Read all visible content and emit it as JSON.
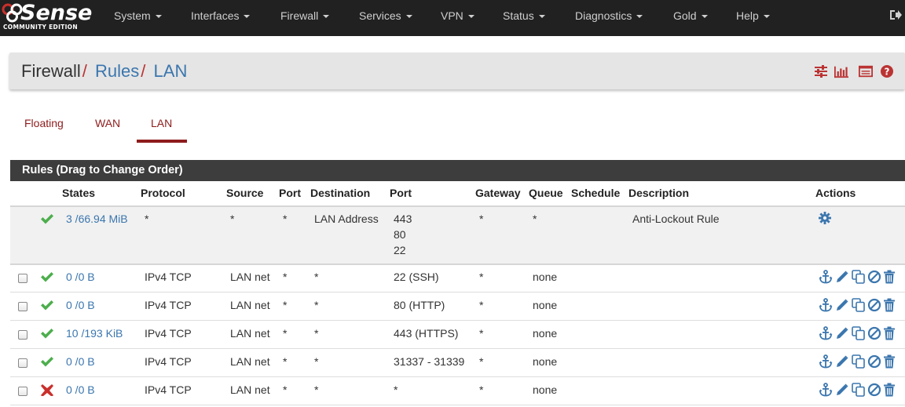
{
  "navbar": {
    "logo_text": "Sense",
    "logo_subtext": "COMMUNITY EDITION",
    "menu": [
      {
        "label": "System"
      },
      {
        "label": "Interfaces"
      },
      {
        "label": "Firewall"
      },
      {
        "label": "Services"
      },
      {
        "label": "VPN"
      },
      {
        "label": "Status"
      },
      {
        "label": "Diagnostics"
      },
      {
        "label": "Gold"
      },
      {
        "label": "Help"
      }
    ],
    "logout_icon": "sign-out-icon"
  },
  "breadcrumb": {
    "root": "Firewall",
    "sep": "/",
    "level1": "Rules",
    "level2": "LAN",
    "icons": [
      "sliders-icon",
      "bar-chart-icon",
      "list-table-icon",
      "help-icon"
    ]
  },
  "tabs": [
    {
      "label": "Floating",
      "active": false
    },
    {
      "label": "WAN",
      "active": false
    },
    {
      "label": "LAN",
      "active": true
    }
  ],
  "panel": {
    "title": "Rules (Drag to Change Order)",
    "columns": {
      "states": "States",
      "protocol": "Protocol",
      "source": "Source",
      "port": "Port",
      "destination": "Destination",
      "dport": "Port",
      "gateway": "Gateway",
      "queue": "Queue",
      "schedule": "Schedule",
      "description": "Description",
      "actions": "Actions"
    }
  },
  "rules": [
    {
      "status": "pass",
      "states": "3 /66.94 MiB",
      "protocol": "*",
      "source": "*",
      "sport": "*",
      "destination": "LAN Address",
      "dport_lines": [
        "443",
        "80",
        "22"
      ],
      "gateway": "*",
      "queue": "*",
      "schedule": "",
      "description": "Anti-Lockout Rule",
      "action_icon": "gear-icon"
    },
    {
      "status": "pass",
      "states": "0 /0 B",
      "protocol": "IPv4 TCP",
      "source": "LAN net",
      "sport": "*",
      "destination": "*",
      "dport": "22 (SSH)",
      "gateway": "*",
      "queue": "none",
      "schedule": "",
      "description": ""
    },
    {
      "status": "pass",
      "states": "0 /0 B",
      "protocol": "IPv4 TCP",
      "source": "LAN net",
      "sport": "*",
      "destination": "*",
      "dport": "80 (HTTP)",
      "gateway": "*",
      "queue": "none",
      "schedule": "",
      "description": ""
    },
    {
      "status": "pass",
      "states": "10 /193 KiB",
      "protocol": "IPv4 TCP",
      "source": "LAN net",
      "sport": "*",
      "destination": "*",
      "dport": "443 (HTTPS)",
      "gateway": "*",
      "queue": "none",
      "schedule": "",
      "description": ""
    },
    {
      "status": "pass",
      "states": "0 /0 B",
      "protocol": "IPv4 TCP",
      "source": "LAN net",
      "sport": "*",
      "destination": "*",
      "dport": "31337 - 31339",
      "gateway": "*",
      "queue": "none",
      "schedule": "",
      "description": ""
    },
    {
      "status": "block",
      "states": "0 /0 B",
      "protocol": "IPv4 TCP",
      "source": "LAN net",
      "sport": "*",
      "destination": "*",
      "dport": "*",
      "gateway": "*",
      "queue": "none",
      "schedule": "",
      "description": ""
    }
  ],
  "row_actions": [
    "anchor-icon",
    "edit-icon",
    "copy-icon",
    "disable-icon",
    "delete-icon"
  ],
  "colors": {
    "navbar_bg": "#212121",
    "link": "#3b76ae",
    "tab_red": "#8e1c1c",
    "pass_green": "#4cae4c",
    "block_red": "#c9302c",
    "panel_head_bg": "#3d3d3d"
  }
}
